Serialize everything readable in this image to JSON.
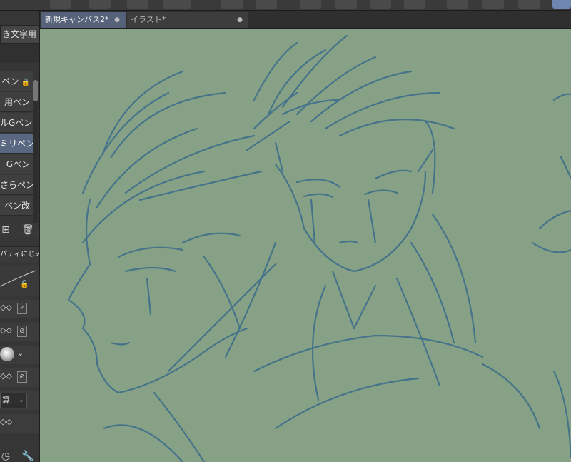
{
  "tabs": [
    {
      "label": "新規キャンバス2*",
      "active": true,
      "close_icon": "dot-icon"
    },
    {
      "label": "イラスト*",
      "active": false,
      "close_icon": "dot-icon"
    }
  ],
  "sidebar": {
    "header": "き文字用",
    "pens": [
      {
        "label": "ペン",
        "locked": true
      },
      {
        "label": "用ペン"
      },
      {
        "label": "ルGペン"
      },
      {
        "label": "ミリペン",
        "selected": true
      },
      {
        "label": "Gペン"
      },
      {
        "label": "さらペン"
      },
      {
        "label": "ペン改"
      }
    ],
    "property_header": "パティにじみ",
    "blend_value": "算",
    "colors": {
      "selected": "#5a6780",
      "canvas": "#86a185",
      "stroke": "#3e6f8a"
    }
  }
}
